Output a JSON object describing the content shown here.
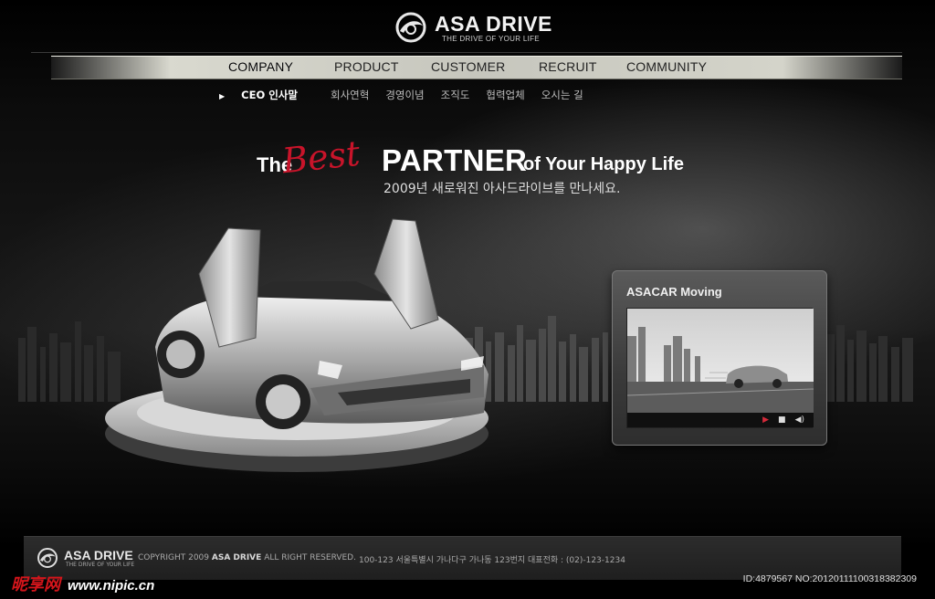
{
  "brand": {
    "name": "ASA DRIVE",
    "tagline": "THE DRIVE OF YOUR LIFE"
  },
  "nav": {
    "items": [
      "COMPANY",
      "PRODUCT",
      "CUSTOMER",
      "RECRUIT",
      "COMMUNITY"
    ],
    "active": "COMPANY"
  },
  "subnav": {
    "items": [
      "CEO 인사말",
      "회사연혁",
      "경영이념",
      "조직도",
      "협력업체",
      "오시는 길"
    ],
    "active": "CEO 인사말"
  },
  "hero": {
    "the": "The",
    "best": "Best",
    "partner": "PARTNER",
    "rest": "of Your Happy Life",
    "subtitle": "2009년 새로워진 아사드라이브를 만나세요."
  },
  "video": {
    "title": "ASACAR Moving"
  },
  "footer": {
    "brand": "ASA DRIVE",
    "tagline": "THE DRIVE OF YOUR LIFE",
    "copyright_prefix": "COPYRIGHT 2009",
    "copyright_brand": "ASA DRIVE",
    "copyright_suffix": "ALL RIGHT RESERVED.",
    "address": "100-123  서울특별시 가나다구 가나동 123번지 대표전화 : (02)-123-1234"
  },
  "watermark": {
    "site_cn": "昵享网",
    "url": "www.nipic.cn",
    "id": "ID:4879567 NO:20120111100318382309"
  },
  "colors": {
    "accent": "#c8142a",
    "nav_bar": "#cfcfc6",
    "background": "#000000"
  }
}
